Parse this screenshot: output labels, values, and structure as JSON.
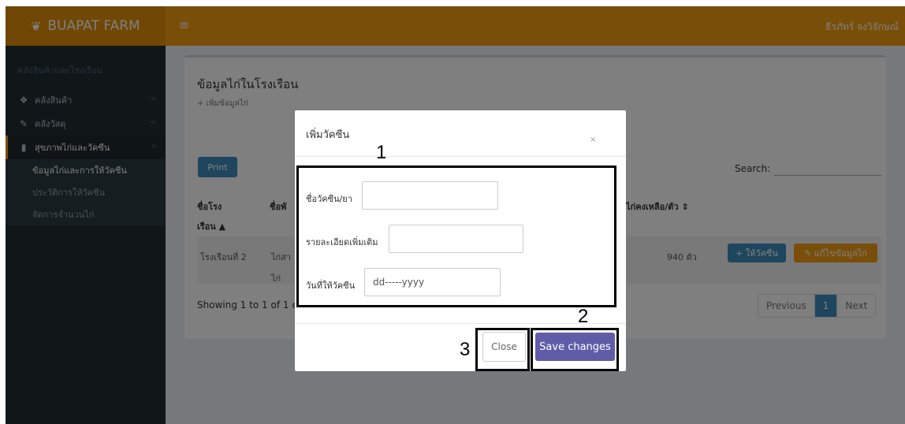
{
  "app": {
    "logo_text": "BUAPAT FARM",
    "menu_icon": "hamburger-icon",
    "user_name": "ธีรภัทร์ จงวิจักษณ์"
  },
  "sidebar": {
    "header": "คลังสินค้าและโรงเรือน",
    "items": [
      {
        "label": "คลังสินค้า",
        "icon": "cubes-icon"
      },
      {
        "label": "คลังวัสดุ",
        "icon": "wrench-icon"
      },
      {
        "label": "สุขภาพไก่และวัคซีน",
        "icon": "book-icon"
      }
    ],
    "subitems": [
      {
        "label": "ข้อมูลไก่และการให้วัคซีน"
      },
      {
        "label": "ประวัติการให้วัคซีน"
      },
      {
        "label": "จัดการจำนวนไก่"
      }
    ]
  },
  "main": {
    "title": "ข้อมูลไก่ในโรงเรือน",
    "add_link": "+ เพิ่มข้อมูลไก่",
    "print_label": "Print",
    "search_label": "Search:",
    "columns": {
      "house_name_line1": "ชื่อโรง",
      "house_name_line2": "เรือน ▲",
      "col2_fragment": "ชื่อพั",
      "remaining_fragment": "ไก่คงเหลือ/ตัว ⇕"
    },
    "row": {
      "house": "โรงเรือนที่ 2",
      "col2_line1": "ไก่สา",
      "col2_line2": "ไก่",
      "remaining": "940 ตัว",
      "vaccinate_label": "+ ให้วัคซีน",
      "edit_label": "✎ แก้ไขข้อมูลไก่"
    },
    "showing": "Showing 1 to 1 of 1 en",
    "pagination": {
      "previous": "Previous",
      "page": "1",
      "next": "Next"
    }
  },
  "modal": {
    "title": "เพิ่มวัคซีน",
    "close_x": "×",
    "fields": {
      "vaccine_name_label": "ชื่อวัคซีน/ยา",
      "details_label": "รายละเอียดเพิ่มเติม",
      "date_label": "วันที่ให้วัคซีน",
      "date_placeholder": "dd-----yyyy"
    },
    "close_label": "Close",
    "save_label": "Save changes"
  },
  "annotations": {
    "one": "1",
    "two": "2",
    "three": "3"
  },
  "colors": {
    "header": "#f39c12",
    "logo_bg": "#e08e0b",
    "sidebar": "#222d32",
    "primary": "#3c8dbc",
    "save": "#605ca8"
  }
}
